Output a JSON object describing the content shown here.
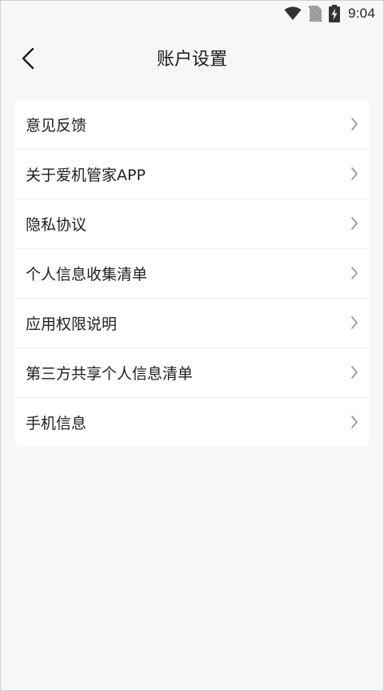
{
  "status_bar": {
    "time": "9:04",
    "icons": [
      "wifi-icon",
      "no-sim-icon",
      "battery-charging-icon"
    ]
  },
  "header": {
    "title": "账户设置",
    "back_icon": "chevron-left-icon"
  },
  "settings": {
    "items": [
      {
        "label": "意见反馈",
        "icon": "chevron-right-icon"
      },
      {
        "label": "关于爱机管家APP",
        "icon": "chevron-right-icon"
      },
      {
        "label": "隐私协议",
        "icon": "chevron-right-icon"
      },
      {
        "label": "个人信息收集清单",
        "icon": "chevron-right-icon"
      },
      {
        "label": "应用权限说明",
        "icon": "chevron-right-icon"
      },
      {
        "label": "第三方共享个人信息清单",
        "icon": "chevron-right-icon"
      },
      {
        "label": "手机信息",
        "icon": "chevron-right-icon"
      }
    ]
  },
  "colors": {
    "background": "#f7f7f7",
    "card": "#ffffff",
    "divider": "#eeeeee",
    "text": "#1f1f1f",
    "chevron": "#9a9a9a"
  }
}
